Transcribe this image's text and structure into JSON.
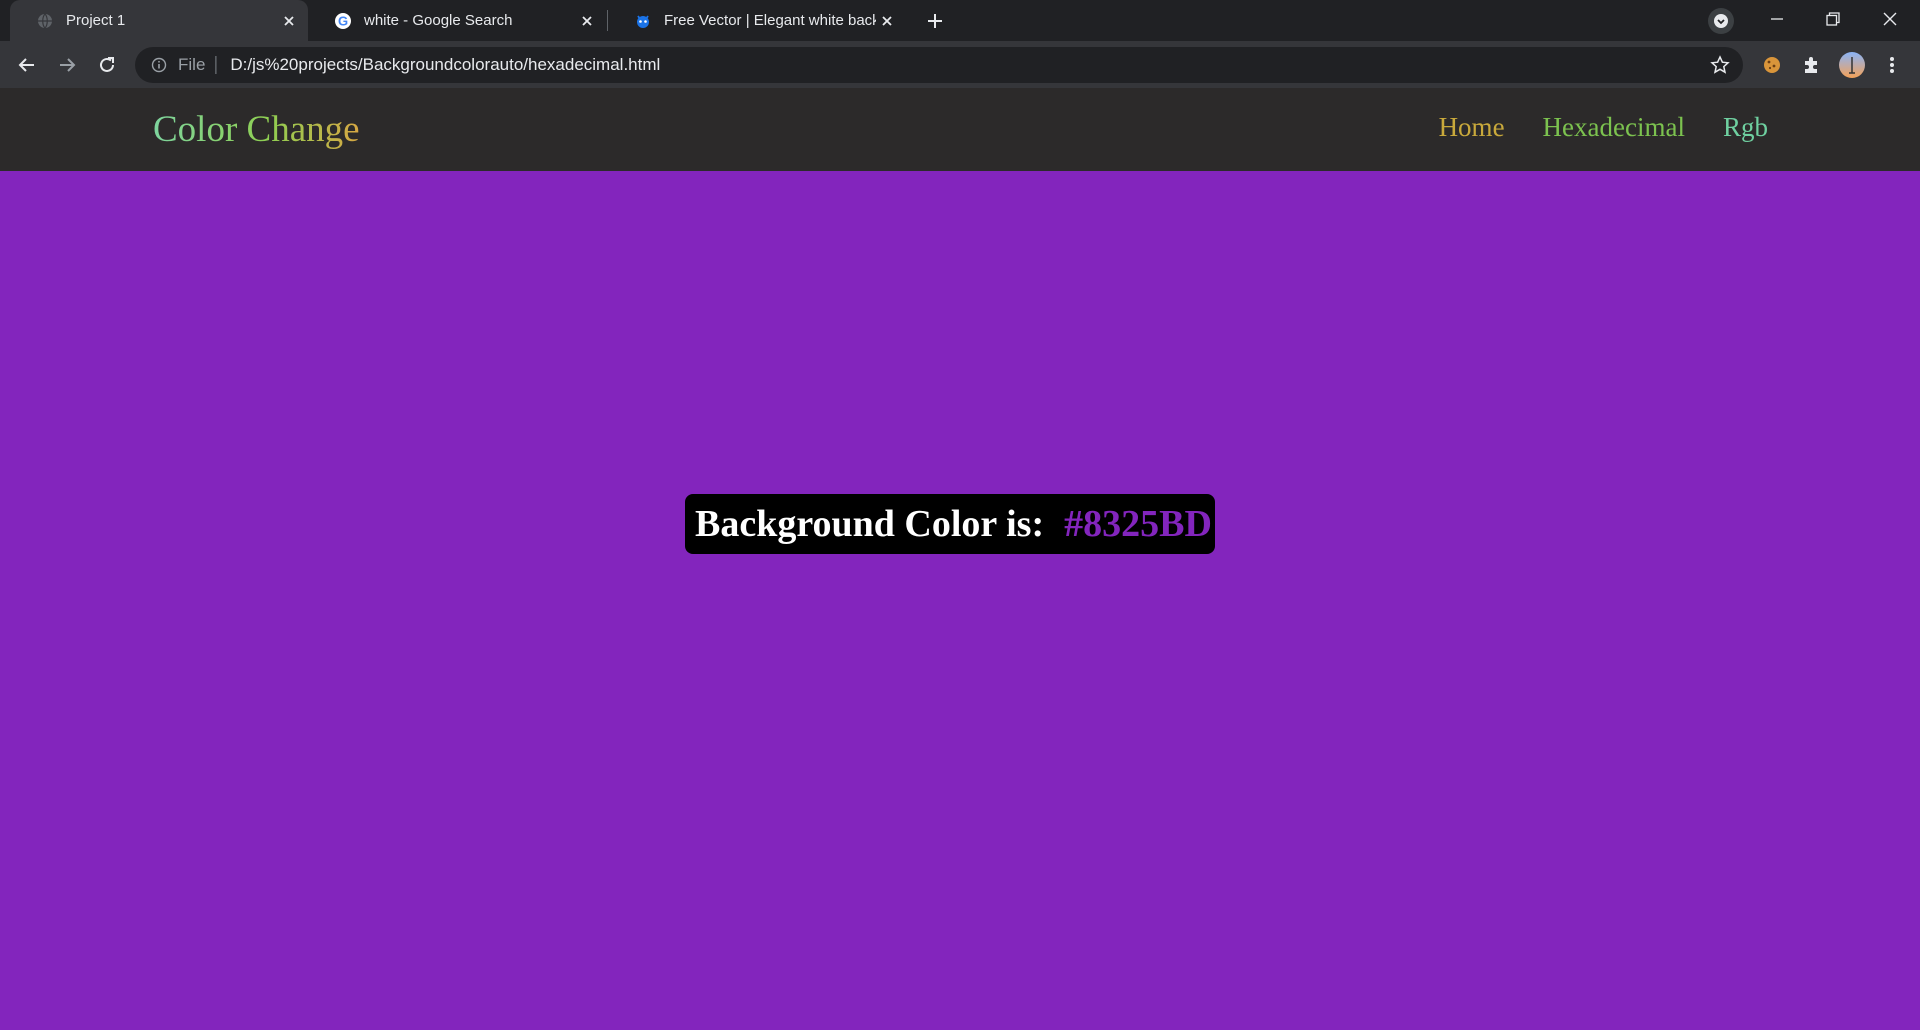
{
  "browser": {
    "tabs": [
      {
        "title": "Project 1",
        "active": true,
        "favicon": "globe-icon"
      },
      {
        "title": "white - Google Search",
        "active": false,
        "favicon": "google-icon"
      },
      {
        "title": "Free Vector | Elegant white backg",
        "active": false,
        "favicon": "freepik-icon"
      }
    ],
    "address_bar": {
      "scheme_label": "File",
      "url": "D:/js%20projects/Backgroundcolorauto/hexadecimal.html"
    }
  },
  "page": {
    "brand": "Color Change",
    "nav": [
      {
        "label": "Home",
        "color": "#c9a93b"
      },
      {
        "label": "Hexadecimal",
        "color": "#7cc24f"
      },
      {
        "label": "Rgb",
        "color": "#6fd0a0"
      }
    ],
    "background_color": "#8325BD",
    "color_label": "Background Color is:",
    "color_value": "#8325BD"
  }
}
